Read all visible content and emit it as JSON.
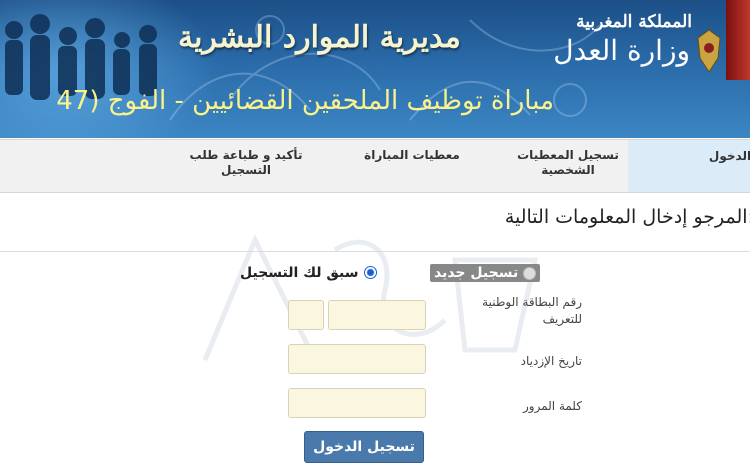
{
  "header": {
    "kingdom": "المملكة المغربية",
    "ministry": "وزارة العدل",
    "department": "مديرية الموارد البشرية",
    "contest_title": "مباراة توظيف الملحقين القضائيين - الفوج (47"
  },
  "steps": [
    {
      "label": "الدخول",
      "active": true
    },
    {
      "label": "تسجيل المعطيات الشخصية",
      "active": false
    },
    {
      "label": "معطيات المباراة",
      "active": false
    },
    {
      "label": "تأكيد و طباعة طلب التسجيل",
      "active": false
    }
  ],
  "form": {
    "instruction": "المرجو إدخال المعلومات التالية:",
    "radio_new": "تسجيل جديد",
    "radio_existing": "سبق لك التسجيل",
    "selected": "existing",
    "cin_label": "رقم البطاقة الوطنية للتعريف",
    "birthdate_label": "تاريخ الإزدياد",
    "password_label": "كلمة المرور",
    "submit_label": "تسجيل الدخول"
  },
  "colors": {
    "banner": "#2a6aa8",
    "title_yellow": "#fbf28a",
    "button": "#4a79ab",
    "field_bg": "#fbf6e0"
  }
}
